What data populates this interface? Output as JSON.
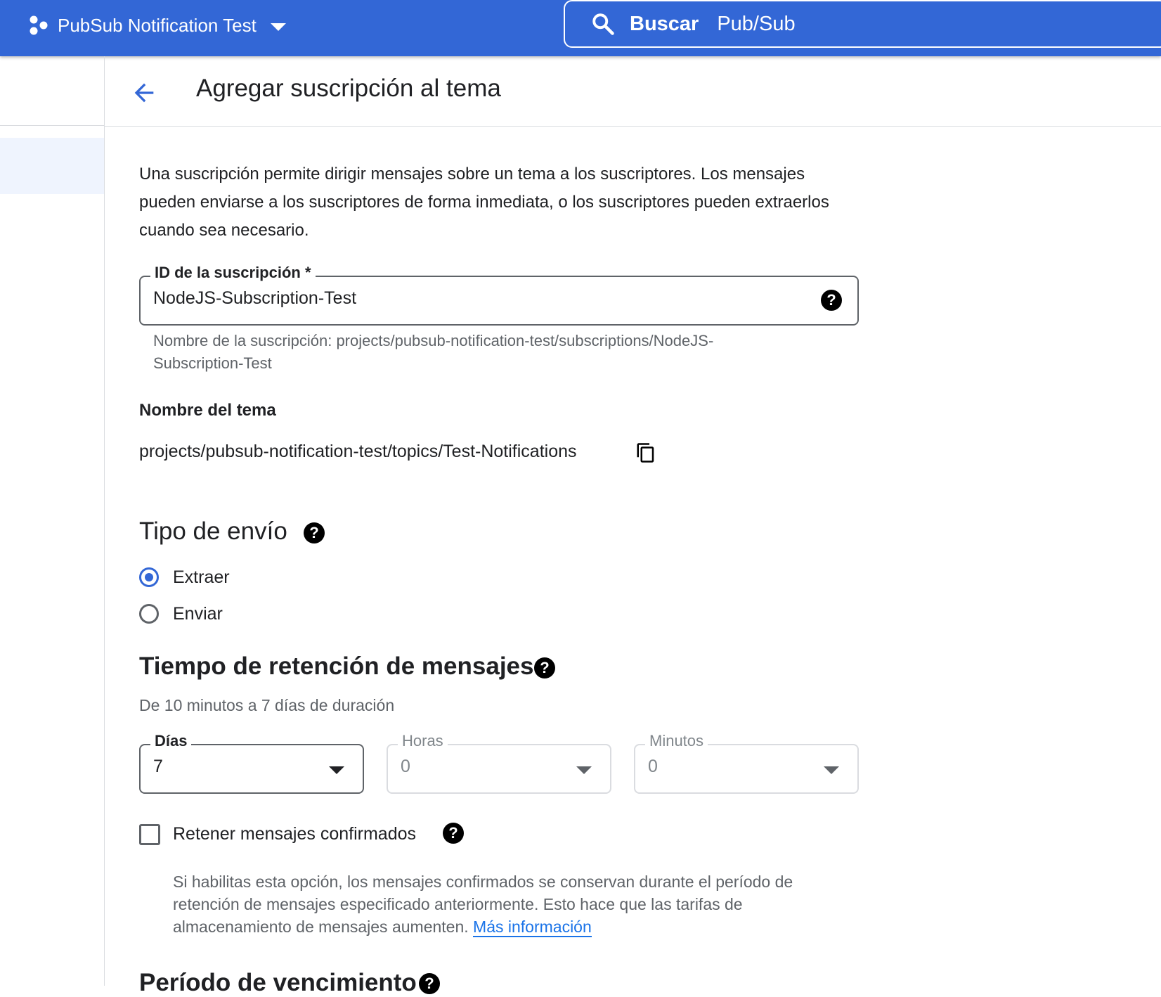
{
  "topbar": {
    "project_name": "PubSub Notification Test",
    "search_label": "Buscar",
    "search_scope": "Pub/Sub",
    "color": "#3367d6"
  },
  "header": {
    "title": "Agregar suscripción al tema"
  },
  "description": "Una suscripción permite dirigir mensajes sobre un tema a los suscriptores. Los mensajes pueden enviarse a los suscriptores de forma inmediata, o los suscriptores pueden extraerlos cuando sea necesario.",
  "subscription_id": {
    "label": "ID de la suscripción *",
    "value": "NodeJS-Subscription-Test",
    "hint_line1": "Nombre de la suscripción: projects/pubsub-notification-test/subscriptions/NodeJS-",
    "hint_line2": "Subscription-Test"
  },
  "topic": {
    "label": "Nombre del tema",
    "value": "projects/pubsub-notification-test/topics/Test-Notifications"
  },
  "delivery_type": {
    "heading": "Tipo de envío",
    "options": [
      {
        "label": "Extraer",
        "selected": true
      },
      {
        "label": "Enviar",
        "selected": false
      }
    ]
  },
  "retention": {
    "heading": "Tiempo de retención de mensajes",
    "subtitle": "De 10 minutos a 7 días de duración",
    "days": {
      "label": "Días",
      "value": "7"
    },
    "hours": {
      "label": "Horas",
      "value": "0"
    },
    "minutes": {
      "label": "Minutos",
      "value": "0"
    }
  },
  "retain_acked": {
    "label": "Retener mensajes confirmados",
    "checked": false,
    "hint": "Si habilitas esta opción, los mensajes confirmados se conservan durante el período de retención de mensajes especificado anteriormente. Esto hace que las tarifas de almacenamiento de mensajes aumenten.",
    "link": "Más información"
  },
  "expiration": {
    "heading": "Período de vencimiento"
  },
  "help_glyph": "?"
}
